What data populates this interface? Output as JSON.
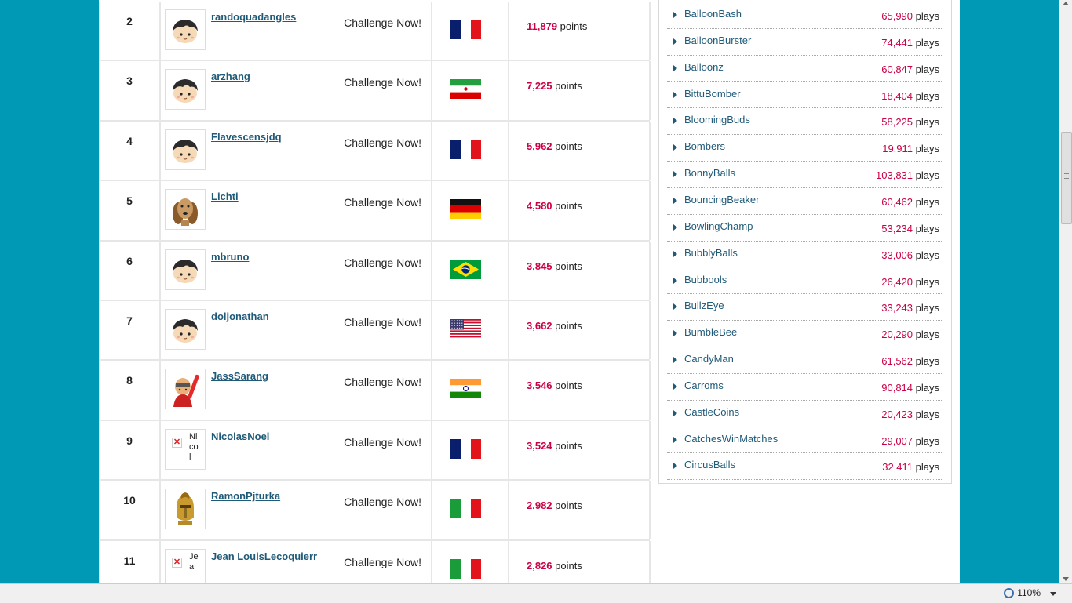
{
  "leaderboard": {
    "challenge_label": "Challenge Now!",
    "points_unit": "points",
    "rows": [
      {
        "rank": "2",
        "user": "randoquadangles",
        "avatar": "default",
        "flag": "france",
        "points": "11,879"
      },
      {
        "rank": "3",
        "user": "arzhang",
        "avatar": "default",
        "flag": "iran",
        "points": "7,225"
      },
      {
        "rank": "4",
        "user": "Flavescensjdq",
        "avatar": "default",
        "flag": "france",
        "points": "5,962"
      },
      {
        "rank": "5",
        "user": "Lichti",
        "avatar": "dog",
        "flag": "germany",
        "points": "4,580"
      },
      {
        "rank": "6",
        "user": "mbruno",
        "avatar": "default",
        "flag": "brazil",
        "points": "3,845"
      },
      {
        "rank": "7",
        "user": "doljonathan",
        "avatar": "default",
        "flag": "usa",
        "points": "3,662"
      },
      {
        "rank": "8",
        "user": "JassSarang",
        "avatar": "warrior",
        "flag": "india",
        "points": "3,546"
      },
      {
        "rank": "9",
        "user": "NicolasNoel",
        "avatar": "broken",
        "avatar_alt": "Nicol",
        "flag": "france",
        "points": "3,524"
      },
      {
        "rank": "10",
        "user": "RamonPjturka",
        "avatar": "helmet",
        "flag": "italy",
        "points": "2,982"
      },
      {
        "rank": "11",
        "user": "Jean LouisLecoquierr",
        "avatar": "broken",
        "avatar_alt": "Jea",
        "flag": "italy",
        "points": "2,826"
      }
    ]
  },
  "games": {
    "plays_unit": "plays",
    "items": [
      {
        "name": "BalloonBash",
        "plays": "65,990"
      },
      {
        "name": "BalloonBurster",
        "plays": "74,441"
      },
      {
        "name": "Balloonz",
        "plays": "60,847"
      },
      {
        "name": "BittuBomber",
        "plays": "18,404"
      },
      {
        "name": "BloomingBuds",
        "plays": "58,225"
      },
      {
        "name": "Bombers",
        "plays": "19,911"
      },
      {
        "name": "BonnyBalls",
        "plays": "103,831"
      },
      {
        "name": "BouncingBeaker",
        "plays": "60,462"
      },
      {
        "name": "BowlingChamp",
        "plays": "53,234"
      },
      {
        "name": "BubblyBalls",
        "plays": "33,006"
      },
      {
        "name": "Bubbools",
        "plays": "26,420"
      },
      {
        "name": "BullzEye",
        "plays": "33,243"
      },
      {
        "name": "BumbleBee",
        "plays": "20,290"
      },
      {
        "name": "CandyMan",
        "plays": "61,562"
      },
      {
        "name": "Carroms",
        "plays": "90,814"
      },
      {
        "name": "CastleCoins",
        "plays": "20,423"
      },
      {
        "name": "CatchesWinMatches",
        "plays": "29,007"
      },
      {
        "name": "CircusBalls",
        "plays": "32,411"
      }
    ]
  },
  "statusbar": {
    "zoom": "110%"
  },
  "colors": {
    "background": "#0099b5",
    "link": "#1f5a78",
    "accent": "#cc0044"
  }
}
